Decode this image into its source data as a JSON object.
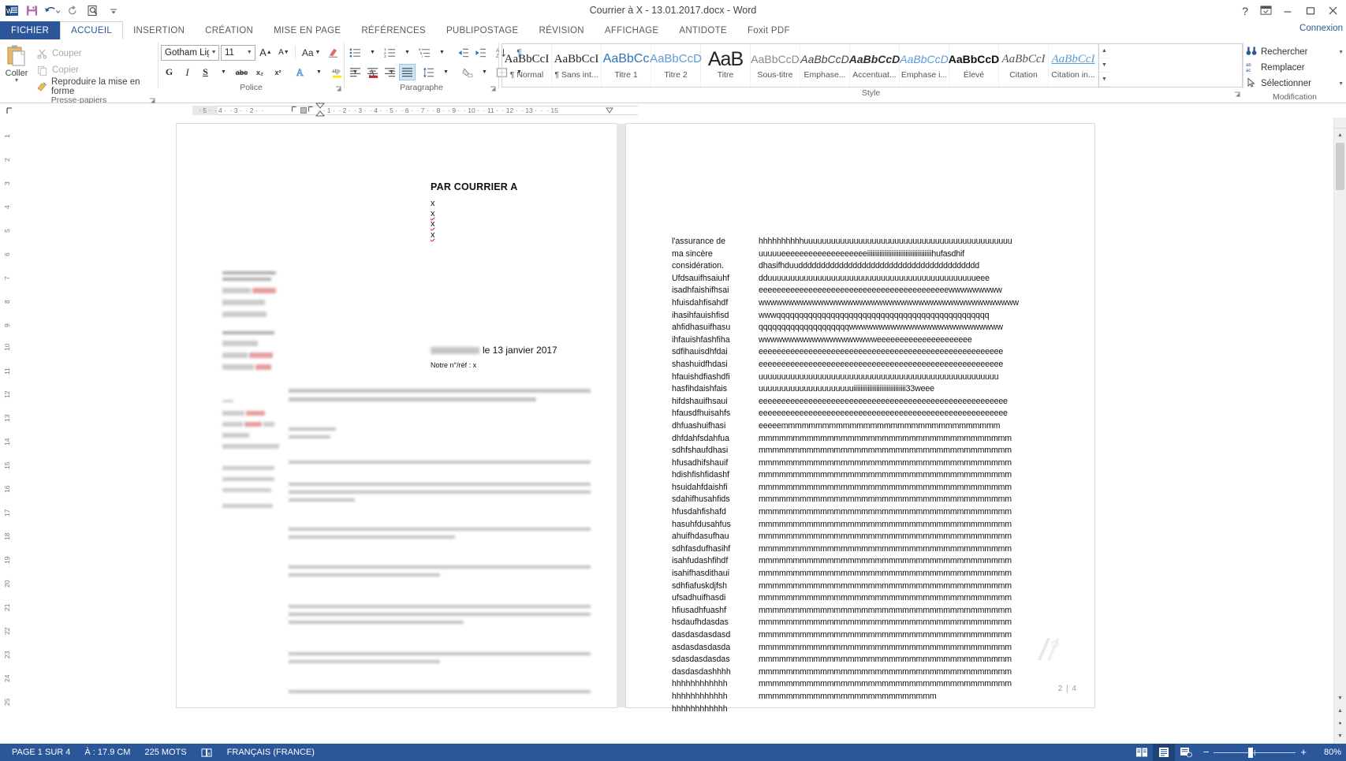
{
  "window": {
    "title": "Courrier à X - 13.01.2017.docx - Word",
    "quick_access": [
      "word-logo",
      "save-icon",
      "undo-icon",
      "redo-icon",
      "print-preview-icon",
      "customize-qat-icon"
    ],
    "help_label": "?",
    "ribbon_display_label": "ribbon-display-options",
    "minimize_label": "–",
    "restore_label": "▫",
    "close_label": "✕",
    "account_label": "Connexion"
  },
  "tabs": [
    {
      "label": "FICHIER",
      "kind": "file"
    },
    {
      "label": "ACCUEIL",
      "kind": "active"
    },
    {
      "label": "INSERTION",
      "kind": "normal"
    },
    {
      "label": "CRÉATION",
      "kind": "normal"
    },
    {
      "label": "MISE EN PAGE",
      "kind": "normal"
    },
    {
      "label": "RÉFÉRENCES",
      "kind": "normal"
    },
    {
      "label": "PUBLIPOSTAGE",
      "kind": "normal"
    },
    {
      "label": "RÉVISION",
      "kind": "normal"
    },
    {
      "label": "AFFICHAGE",
      "kind": "normal"
    },
    {
      "label": "ANTIDOTE",
      "kind": "normal"
    },
    {
      "label": "Foxit PDF",
      "kind": "plain"
    }
  ],
  "ribbon": {
    "clipboard": {
      "group_label": "Presse-papiers",
      "paste_label": "Coller",
      "cut_label": "Couper",
      "copy_label": "Copier",
      "format_painter_label": "Reproduire la mise en forme"
    },
    "font": {
      "group_label": "Police",
      "font_name": "Gotham Ligh",
      "font_size": "11",
      "grow_label": "A",
      "shrink_label": "A",
      "change_case_label": "Aa",
      "clear_format_label": "clear-formatting",
      "bold_label": "G",
      "italic_label": "I",
      "underline_label": "S",
      "strike_label": "abc",
      "subscript_label": "x₂",
      "superscript_label": "x²",
      "text_effects_label": "A",
      "highlight_label": "ab",
      "font_color_label": "A"
    },
    "paragraph": {
      "group_label": "Paragraphe",
      "bullets_label": "bullet-list",
      "numbering_label": "numbered-list",
      "multilevel_label": "multilevel-list",
      "decrease_indent_label": "decrease-indent",
      "increase_indent_label": "increase-indent",
      "sort_label": "sort",
      "show_marks_label": "¶",
      "align_left_label": "align-left",
      "align_center_label": "align-center",
      "align_right_label": "align-right",
      "align_justify_label": "align-justify",
      "line_spacing_label": "line-spacing",
      "shading_label": "shading",
      "borders_label": "borders",
      "active_alignment": "align-justify"
    },
    "styles": {
      "group_label": "Style",
      "items": [
        {
          "preview": "AaBbCcI",
          "name": "¶ Normal",
          "style": "serif-normal"
        },
        {
          "preview": "AaBbCcI",
          "name": "¶ Sans int...",
          "style": "serif-normal"
        },
        {
          "preview": "AaBbCc",
          "name": "Titre 1",
          "style": "blue"
        },
        {
          "preview": "AaBbCcD",
          "name": "Titre 2",
          "style": "blue-light"
        },
        {
          "preview": "AaB",
          "name": "Titre",
          "style": "big"
        },
        {
          "preview": "AaBbCcD",
          "name": "Sous-titre",
          "style": "gray"
        },
        {
          "preview": "AaBbCcD",
          "name": "Emphase...",
          "style": "italic"
        },
        {
          "preview": "AaBbCcD",
          "name": "Accentuat...",
          "style": "bold-italic"
        },
        {
          "preview": "AaBbCcD",
          "name": "Emphase i...",
          "style": "blue-italic"
        },
        {
          "preview": "AaBbCcD",
          "name": "Élevé",
          "style": "bold"
        },
        {
          "preview": "AaBbCcI",
          "name": "Citation",
          "style": "serif-italic"
        },
        {
          "preview": "AaBbCcI",
          "name": "Citation in...",
          "style": "blue-serif-underline"
        }
      ]
    },
    "editing": {
      "group_label": "Modification",
      "find_label": "Rechercher",
      "replace_label": "Remplacer",
      "select_label": "Sélectionner"
    }
  },
  "ruler": {
    "corner_label": "L",
    "left_ticks": [
      "5",
      "4",
      "3",
      "2"
    ],
    "right_ticks": [
      "1",
      "2",
      "3",
      "4",
      "5",
      "6",
      "7",
      "8",
      "9",
      "10",
      "11",
      "12",
      "13",
      "15"
    ]
  },
  "vertical_ruler_marks": [
    "1",
    "2",
    "3",
    "4",
    "5",
    "6",
    "7",
    "8",
    "9",
    "10",
    "11",
    "12",
    "13",
    "14",
    "15",
    "16",
    "17",
    "18",
    "19",
    "20",
    "21",
    "22",
    "23",
    "24",
    "25"
  ],
  "document": {
    "page1": {
      "kicker": "PAR COURRIER A",
      "recipient_lines": [
        {
          "text": "x",
          "misspelled": false
        },
        {
          "text": "x",
          "misspelled": true
        },
        {
          "text": "x",
          "misspelled": true
        },
        {
          "text": "x",
          "misspelled": true
        }
      ],
      "date_line": "le 13 janvier 2017",
      "ref_line": "Notre n°/réf : x"
    },
    "page2": {
      "page_indicator": "2 | 4",
      "left_column": [
        "l'assurance de",
        "ma sincère",
        "considération.",
        "Ufdsauifhsaiuhf",
        "isadhfaishifhsai",
        "hfuisdahfisahdf",
        "ihasihfauishfisd",
        "ahfidhasuifhasu",
        "ihfauishfashfiha",
        "sdfihauisdhfdai",
        "shashuidfhdasi",
        "hfauishdfiashdfi",
        "hasfihdaishfais",
        "hifdshauifhsaui",
        "hfausdfhuisahfs",
        "dhfuashuifhasi",
        "dhfdahfsdahfua",
        "sdhfshaufdhasi",
        "hfusadhifshauif",
        "hdishfishfidashf",
        "hsuidahfdaishfi",
        "sdahifhusahfids",
        "hfusdahfishafd",
        "hasuhfdusahfus",
        "ahuifhdasufhau",
        "sdhfasdufhasihf",
        "isahfudashfihdf",
        "isahifhasdithaui",
        "sdhfiafuskdjfsh",
        "ufsadhuifhasdi",
        "hfiusadhfuashf",
        "hsdaufhdasdas",
        "dasdasdasdasd",
        "asdasdasdasda",
        "sdasdasdasdas",
        "dasdasdashhhh",
        "hhhhhhhhhhhh",
        "hhhhhhhhhhhh",
        "hhhhhhhhhhhh"
      ],
      "right_column": [
        "hhhhhhhhhhuuuuuuuuuuuuuuuuuuuuuuuuuuuuuuuuuuuuuuuuuuuuuu",
        "uuuuueeeeeeeeeeeeeeeeeeeiiiiiiiiiiiiiiiiiiiiiiiiiiiiiiiiiiiiihufasdhif",
        "dhasifhduudddddddddddddddddddddddddddddddddddddddd",
        "dduuuuuuuuuuuuuuuuuuuuuuuuuuuuuuuuuuuuuuuuuuuuuueee",
        "eeeeeeeeeeeeeeeeeeeeeeeeeeeeeeeeeeeeeeeeeewwwwwwwww",
        "wwwwwwwwwwwwwwwwwwwwwwwwwwwwwwwwwwwwwwwwwwww",
        "wwwqqqqqqqqqqqqqqqqqqqqqqqqqqqqqqqqqqqqqqqqqqqqqqq",
        "qqqqqqqqqqqqqqqqqqqqwwwwwwwwwwwwwwwwwwwwwwwwww",
        "wwwwwwwwwwwwwwwwwwwweeeeeeeeeeeeeeeeeeeee",
        "eeeeeeeeeeeeeeeeeeeeeeeeeeeeeeeeeeeeeeeeeeeeeeeeeeeeee",
        "eeeeeeeeeeeeeeeeeeeeeeeeeeeeeeeeeeeeeeeeeeeeeeeeeeeeee",
        "uuuuuuuuuuuuuuuuuuuuuuuuuuuuuuuuuuuuuuuuuuuuuuuuuuuuu",
        "uuuuuuuuuuuuuuuuuuuuuiiiiiiiiiiiiiiiiiiiiiiiiiiiiii33weee",
        "eeeeeeeeeeeeeeeeeeeeeeeeeeeeeeeeeeeeeeeeeeeeeeeeeeeeeee",
        "eeeeeeeeeeeeeeeeeeeeeeeeeeeeeeeeeeeeeeeeeeeeeeeeeeeeeee",
        "eeeeemmmmmmmmmmmmmmmmmmmmmmmmmmmmmmmm",
        "mmmmmmmmmmmmmmmmmmmmmmmmmmmmmmmmmmmmm",
        "mmmmmmmmmmmmmmmmmmmmmmmmmmmmmmmmmmmmm",
        "mmmmmmmmmmmmmmmmmmmmmmmmmmmmmmmmmmmmm",
        "mmmmmmmmmmmmmmmmmmmmmmmmmmmmmmmmmmmmm",
        "mmmmmmmmmmmmmmmmmmmmmmmmmmmmmmmmmmmmm",
        "mmmmmmmmmmmmmmmmmmmmmmmmmmmmmmmmmmmmm",
        "mmmmmmmmmmmmmmmmmmmmmmmmmmmmmmmmmmmmm",
        "mmmmmmmmmmmmmmmmmmmmmmmmmmmmmmmmmmmmm",
        "mmmmmmmmmmmmmmmmmmmmmmmmmmmmmmmmmmmmm",
        "mmmmmmmmmmmmmmmmmmmmmmmmmmmmmmmmmmmmm",
        "mmmmmmmmmmmmmmmmmmmmmmmmmmmmmmmmmmmmm",
        "mmmmmmmmmmmmmmmmmmmmmmmmmmmmmmmmmmmmm",
        "mmmmmmmmmmmmmmmmmmmmmmmmmmmmmmmmmmmmm",
        "mmmmmmmmmmmmmmmmmmmmmmmmmmmmmmmmmmmmm",
        "mmmmmmmmmmmmmmmmmmmmmmmmmmmmmmmmmmmmm",
        "mmmmmmmmmmmmmmmmmmmmmmmmmmmmmmmmmmmmm",
        "mmmmmmmmmmmmmmmmmmmmmmmmmmmmmmmmmmmmm",
        "mmmmmmmmmmmmmmmmmmmmmmmmmmmmmmmmmmmmm",
        "mmmmmmmmmmmmmmmmmmmmmmmmmmmmmmmmmmmmm",
        "mmmmmmmmmmmmmmmmmmmmmmmmmmmmmmmmmmmmm",
        "mmmmmmmmmmmmmmmmmmmmmmmmmmmmmmmmmmmmm",
        "mmmmmmmmmmmmmmmmmmmmmmmmmm"
      ]
    }
  },
  "statusbar": {
    "page_label": "PAGE 1 SUR 4",
    "position_label": "À : 17.9 CM",
    "words_label": "225 MOTS",
    "proofing_label": "proofing-icon",
    "language_label": "FRANÇAIS (FRANCE)",
    "view_read_label": "read-mode-icon",
    "view_print_label": "print-layout-icon",
    "view_web_label": "web-layout-icon",
    "zoom_out_label": "−",
    "zoom_in_label": "+",
    "zoom_value": "80%"
  }
}
